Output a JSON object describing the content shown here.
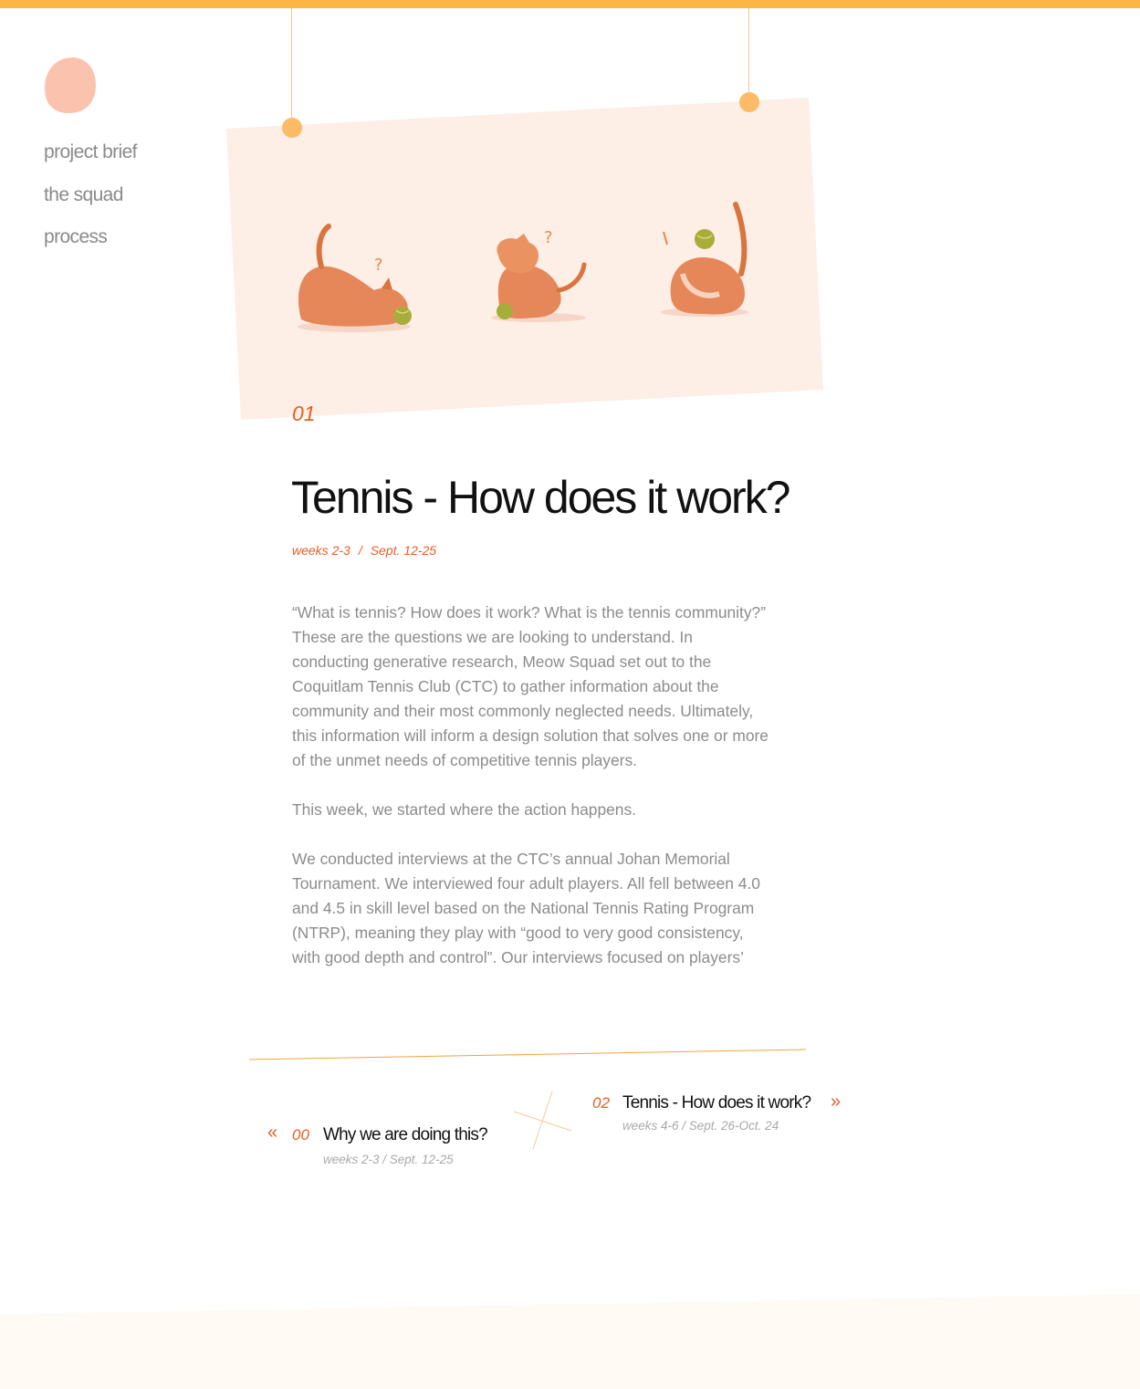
{
  "colors": {
    "accent_bar": "#fdb644",
    "accent_text": "#e85d23",
    "logo_blob": "#fbc2ad",
    "card": "#fdeee6",
    "pin": "#fdbb67",
    "body_text": "#8c8c8c",
    "footer": "#fffbf4"
  },
  "logo": {
    "icon": "pink-blob-logo-icon"
  },
  "nav": {
    "items": [
      {
        "label": "project brief"
      },
      {
        "label": "the squad"
      },
      {
        "label": "process"
      }
    ]
  },
  "hero": {
    "illustration": "three-cats-playing-with-tennis-balls",
    "section_number": "01"
  },
  "article": {
    "title": "Tennis - How does it work?",
    "weeks": "weeks 2-3",
    "meta_separator": "/",
    "dates": "Sept. 12-25",
    "paragraphs": [
      "“What is tennis? How does it work? What is the tennis community?” These are the questions we are looking to understand. In conducting generative research, Meow Squad set out to the Coquitlam Tennis Club (CTC) to gather information about the community and their most commonly neglected needs. Ultimately, this information will inform a design solution that solves one or more of the unmet needs of competitive tennis players.",
      "This week, we started where the action happens.",
      "We conducted interviews at the CTC’s annual Johan Memorial Tournament. We interviewed four adult players. All fell between 4.0 and 4.5 in skill level based on the National Tennis Rating Program (NTRP), meaning they play with “good to very good consistency, with good depth and control”. Our interviews focused on players’"
    ]
  },
  "pagination": {
    "prev": {
      "arrow": "«",
      "number": "00",
      "title": "Why we are doing this?",
      "meta": "weeks 2-3 / Sept. 12-25"
    },
    "next": {
      "arrow": "»",
      "number": "02",
      "title": "Tennis - How does it work?",
      "meta": "weeks 4-6 / Sept. 26-Oct. 24"
    }
  }
}
